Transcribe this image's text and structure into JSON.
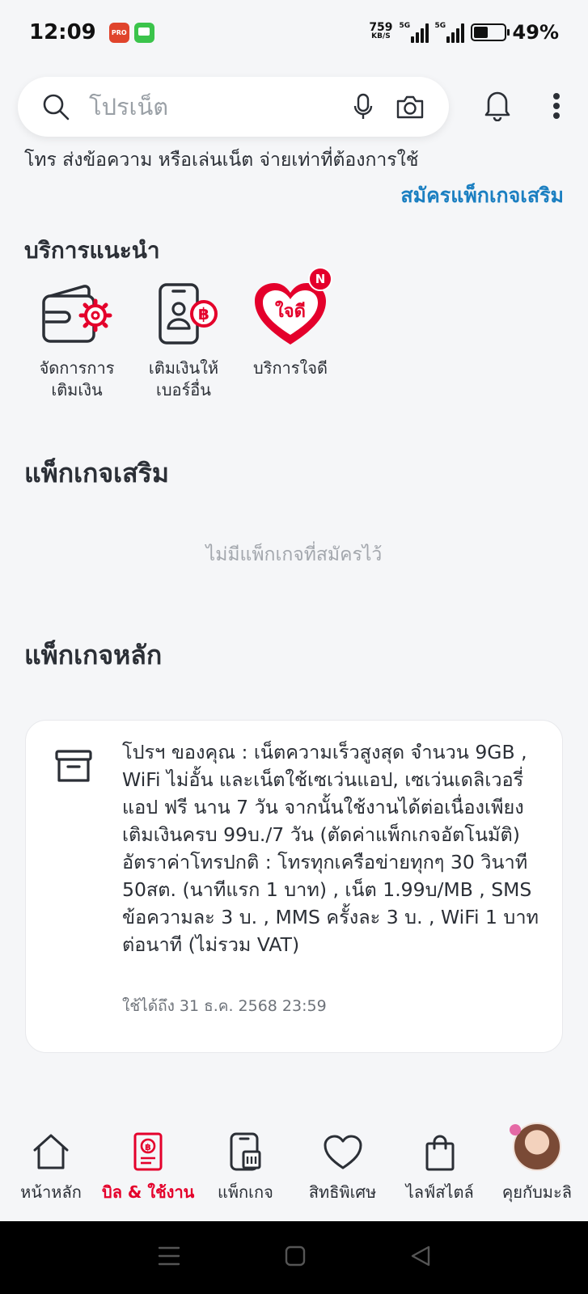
{
  "status_bar": {
    "time": "12:09",
    "net_speed_value": "759",
    "net_speed_unit": "KB/S",
    "signal_1_label": "5G",
    "signal_2_label": "5G",
    "battery_percent": "49%",
    "battery_level": 0.49
  },
  "search": {
    "placeholder": "โปรเน็ต"
  },
  "intro": {
    "text": "โทร ส่งข้อความ หรือเล่นเน็ต จ่ายเท่าที่ต้องการใช้",
    "addon_link": "สมัครแพ็กเกจเสริม"
  },
  "recommended": {
    "title": "บริการแนะนำ",
    "items": [
      {
        "line1": "จัดการการ",
        "line2": "เติมเงิน",
        "icon": "wallet-gear-icon"
      },
      {
        "line1": "เติมเงินให้",
        "line2": "เบอร์อื่น",
        "icon": "phone-baht-icon"
      },
      {
        "line1": "บริการใจดี",
        "line2": "",
        "icon": "jaidee-heart-icon",
        "logo_text": "ใจดี",
        "badge": "N"
      }
    ]
  },
  "addon_packages": {
    "title": "แพ็กเกจเสริม",
    "empty_text": "ไม่มีแพ็กเกจที่สมัครไว้"
  },
  "main_package": {
    "title": "แพ็กเกจหลัก",
    "description": "โปรฯ ของคุณ : เน็ตความเร็วสูงสุด จำนวน 9GB , WiFi ไม่อั้น และเน็ตใช้เซเว่นแอป, เซเว่นเดลิเวอรี่แอป ฟรี นาน 7 วัน จากนั้นใช้งานได้ต่อเนื่องเพียงเติมเงินครบ 99บ./7 วัน (ตัดค่าแพ็กเกจอัตโนมัติ) อัตราค่าโทรปกติ : โทรทุกเครือข่ายทุกๆ 30 วินาที 50สต. (นาทีแรก 1 บาท) , เน็ต 1.99บ/MB , SMS ข้อความละ 3 บ. , MMS ครั้งละ 3 บ. , WiFi 1 บาท ต่อนาที (ไม่รวม VAT)",
    "expiry": "ใช้ได้ถึง 31 ธ.ค. 2568 23:59",
    "icon": "archive-box-icon"
  },
  "bottom_nav": {
    "items": [
      {
        "label": "หน้าหลัก",
        "icon": "home-icon",
        "active": false
      },
      {
        "label": "บิล & ใช้งาน",
        "icon": "bill-icon",
        "active": true
      },
      {
        "label": "แพ็กเกจ",
        "icon": "package-phone-icon",
        "active": false
      },
      {
        "label": "สิทธิพิเศษ",
        "icon": "heart-icon",
        "active": false
      },
      {
        "label": "ไลฟ์สไตล์",
        "icon": "shopping-bag-icon",
        "active": false
      },
      {
        "label": "คุยกับมะลิ",
        "icon": "mali-avatar",
        "active": false
      }
    ]
  },
  "colors": {
    "accent_red": "#e4002b",
    "link_blue": "#1b7fc1",
    "text": "#2b2f36",
    "background": "#f5f6f8"
  }
}
